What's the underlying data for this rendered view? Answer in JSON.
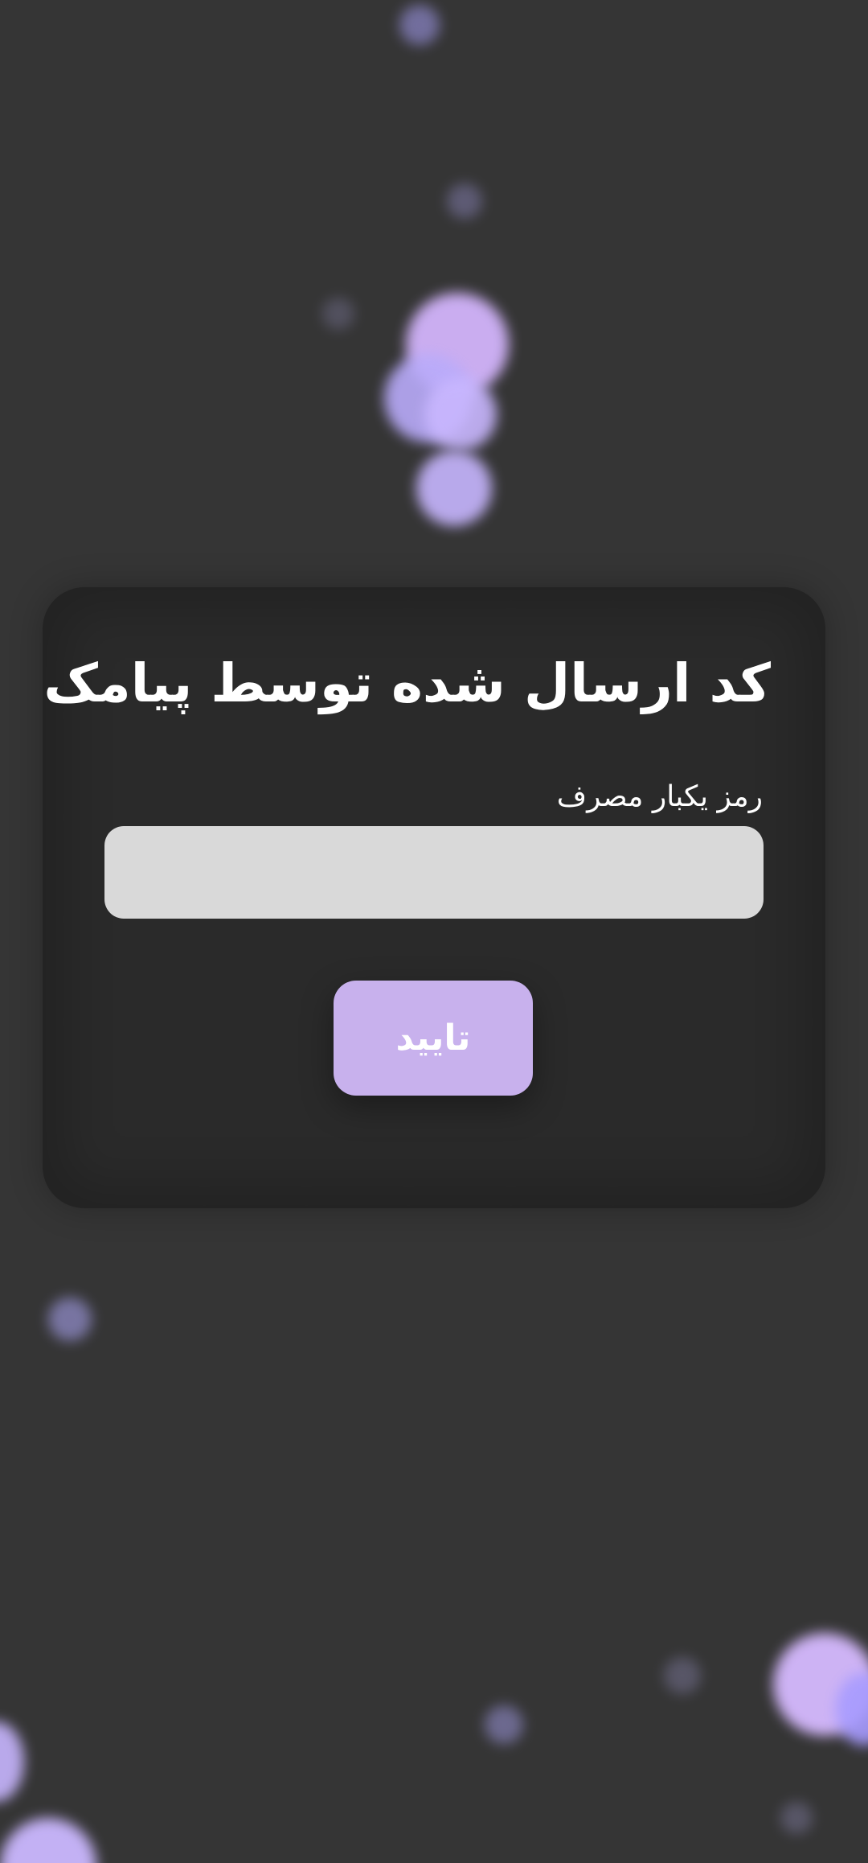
{
  "otp_form": {
    "title": "کد ارسال شده توسط پیامک",
    "field_label": "رمز یکبار مصرف",
    "field_value": "",
    "confirm_label": "تایید"
  },
  "colors": {
    "background": "#353535",
    "card": "#2a2a2a",
    "input": "#d9d9d9",
    "button": "#c8b1ed",
    "bubble_light": "#d6baff",
    "bubble_blue": "#a79bff"
  }
}
